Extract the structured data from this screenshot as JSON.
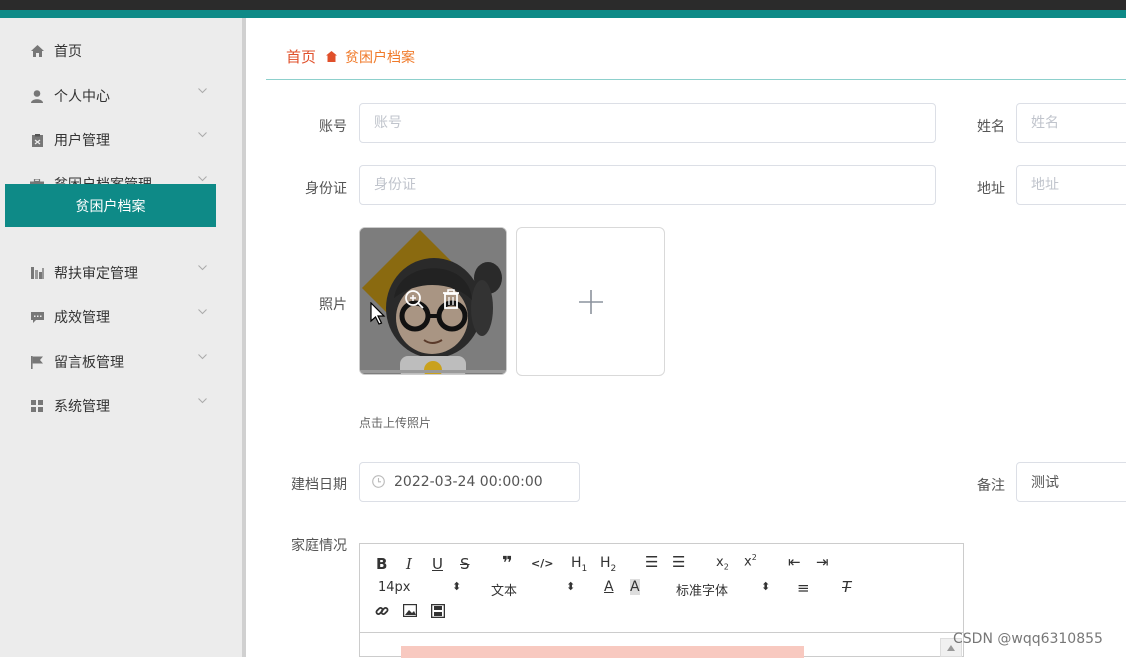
{
  "sidebar": {
    "items": [
      {
        "label": "首页",
        "icon": "home-icon"
      },
      {
        "label": "个人中心",
        "icon": "user-icon"
      },
      {
        "label": "用户管理",
        "icon": "clipboard-icon"
      },
      {
        "label": "贫困户档案管理",
        "icon": "briefcase-icon"
      },
      {
        "label": "帮扶审定管理",
        "icon": "bar-chart-icon"
      },
      {
        "label": "成效管理",
        "icon": "chat-icon"
      },
      {
        "label": "留言板管理",
        "icon": "flag-icon"
      },
      {
        "label": "系统管理",
        "icon": "grid-icon"
      }
    ],
    "active_sub": "贫困户档案"
  },
  "breadcrumb": {
    "home": "首页",
    "current": "贫困户档案"
  },
  "form": {
    "account_label": "账号",
    "account_placeholder": "账号",
    "name_label": "姓名",
    "name_placeholder": "姓名",
    "idcard_label": "身份证",
    "idcard_placeholder": "身份证",
    "address_label": "地址",
    "address_placeholder": "地址",
    "photo_label": "照片",
    "upload_hint": "点击上传照片",
    "date_label": "建档日期",
    "date_value": "2022-03-24 00:00:00",
    "remark_label": "备注",
    "remark_value": "测试",
    "family_label": "家庭情况"
  },
  "editor": {
    "font_size": "14px",
    "block_type": "文本",
    "font_family": "标准字体"
  },
  "watermark": "CSDN @wqq6310855",
  "colors": {
    "accent": "#0e8a87",
    "breadcrumb": "#e0502b"
  }
}
